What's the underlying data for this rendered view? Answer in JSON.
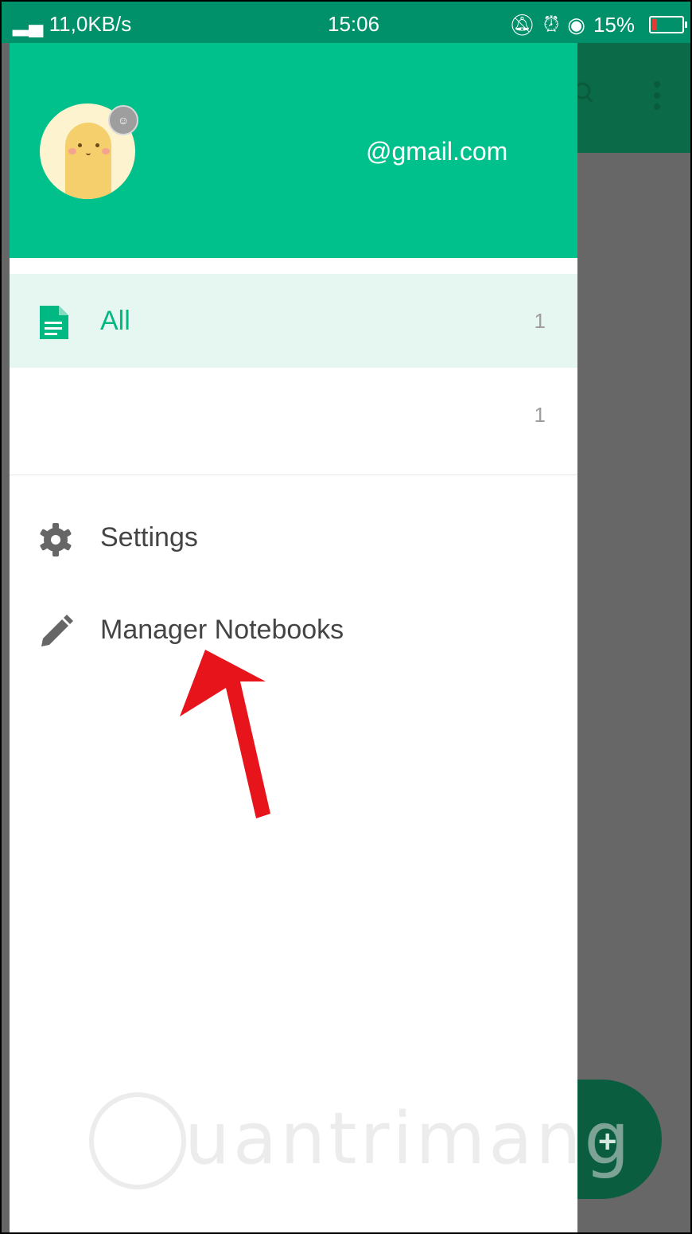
{
  "status_bar": {
    "network": "11,0KB/s",
    "time": "15:06",
    "battery": "15%"
  },
  "drawer": {
    "email": "@gmail.com",
    "notebooks": [
      {
        "label": "All",
        "count": "1",
        "icon": "document-icon"
      },
      {
        "label": "",
        "count": "1"
      }
    ],
    "menu": [
      {
        "label": "Settings",
        "icon": "gear-icon"
      },
      {
        "label": "Manager Notebooks",
        "icon": "pencil-icon"
      }
    ]
  },
  "watermark": {
    "text": "uantrimang"
  },
  "colors": {
    "drawer_header": "#00c08b",
    "status_bar": "#00916b",
    "active_row": "#e6f7f1",
    "accent": "#00b982",
    "annotation_arrow": "#e8141c"
  }
}
